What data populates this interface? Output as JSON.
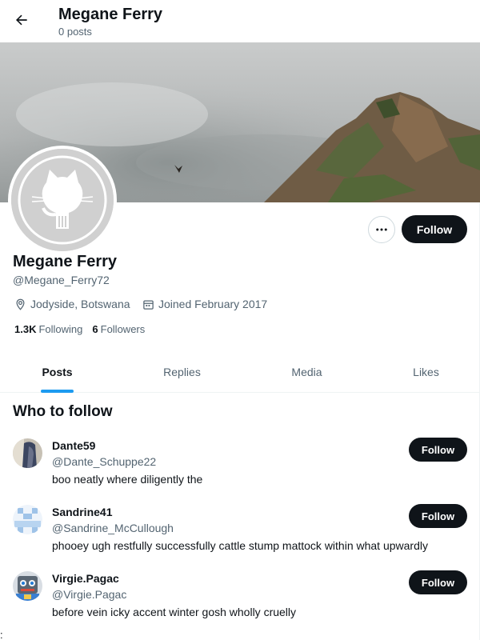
{
  "header": {
    "title": "Megane Ferry",
    "posts_count": "0 posts"
  },
  "profile": {
    "name": "Megane Ferry",
    "handle": "@Megane_Ferry72",
    "location": "Jodyside, Botswana",
    "joined": "Joined February 2017",
    "following_count": "1.3K",
    "following_label": "Following",
    "followers_count": "6",
    "followers_label": "Followers",
    "follow_label": "Follow"
  },
  "tabs": [
    {
      "label": "Posts",
      "active": true
    },
    {
      "label": "Replies",
      "active": false
    },
    {
      "label": "Media",
      "active": false
    },
    {
      "label": "Likes",
      "active": false
    }
  ],
  "who_to_follow": {
    "title": "Who to follow",
    "users": [
      {
        "name": "Dante59",
        "handle": "@Dante_Schuppe22",
        "bio": "boo neatly where diligently the",
        "follow_label": "Follow"
      },
      {
        "name": "Sandrine41",
        "handle": "@Sandrine_McCullough",
        "bio": "phooey ugh restfully successfully cattle stump mattock within what upwardly",
        "follow_label": "Follow"
      },
      {
        "name": "Virgie.Pagac",
        "handle": "@Virgie.Pagac",
        "bio": "before vein icky accent winter gosh wholly cruelly",
        "follow_label": "Follow"
      }
    ]
  },
  "stray_char": ":",
  "colors": {
    "accent": "#1d9bf0",
    "button_dark": "#0f1419",
    "secondary_text": "#536471"
  }
}
